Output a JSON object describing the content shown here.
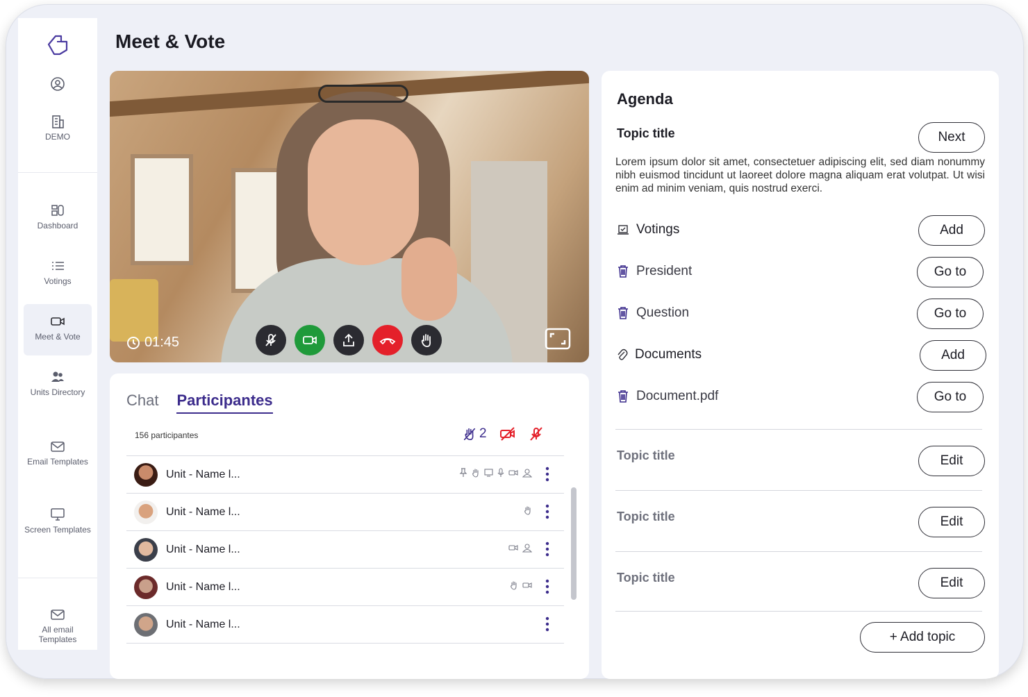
{
  "app": {
    "title": "Meet & Vote"
  },
  "sidebar": {
    "logo_icon": "thumbs-up-hand-icon",
    "items": [
      {
        "label": "",
        "icon": "user-circle-icon"
      },
      {
        "label": "DEMO",
        "icon": "building-icon"
      },
      {
        "label": "Dashboard",
        "icon": "dashboard-icon"
      },
      {
        "label": "Votings",
        "icon": "list-icon"
      },
      {
        "label": "Meet & Vote",
        "icon": "video-icon",
        "active": true
      },
      {
        "label": "Units Directory",
        "icon": "people-icon"
      },
      {
        "label": "Email Templates",
        "icon": "mail-icon"
      },
      {
        "label": "Screen Templates",
        "icon": "monitor-icon"
      },
      {
        "label": "All email Templates",
        "icon": "mail-icon"
      }
    ]
  },
  "video": {
    "timer": "01:45",
    "controls": [
      "mic-off-icon",
      "camera-icon",
      "share-icon",
      "hang-up-icon",
      "raise-hand-icon"
    ],
    "colors": {
      "camera": "#1f9a3a",
      "hangup": "#e4202a",
      "default": "#2b2b31"
    }
  },
  "participants": {
    "tabs": {
      "chat": "Chat",
      "participants": "Participantes"
    },
    "count_label": "156 participantes",
    "raised_hands": "2",
    "rows": [
      {
        "name": "Unit - Name l...",
        "icons": [
          "pin",
          "hand",
          "screen",
          "mic",
          "camera",
          "user"
        ]
      },
      {
        "name": "Unit - Name l...",
        "icons": [
          "hand"
        ]
      },
      {
        "name": "Unit - Name l...",
        "icons": [
          "camera",
          "user"
        ]
      },
      {
        "name": "Unit - Name l...",
        "icons": [
          "hand",
          "camera"
        ]
      },
      {
        "name": "Unit - Name l...",
        "icons": []
      }
    ]
  },
  "agenda": {
    "title": "Agenda",
    "current_topic": "Topic title",
    "next_label": "Next",
    "description": "Lorem ipsum dolor sit amet, consectetuer adipiscing elit, sed diam nonummy nibh euismod tincidunt ut laoreet dolore magna aliquam erat volutpat. Ut wisi enim ad minim veniam, quis nostrud exerci.",
    "votings_label": "Votings",
    "add_label": "Add",
    "voting_items": [
      "President",
      "Question"
    ],
    "goto_label": "Go to",
    "documents_label": "Documents",
    "document_items": [
      "Document.pdf"
    ],
    "other_topics": [
      "Topic title",
      "Topic title",
      "Topic title"
    ],
    "edit_label": "Edit",
    "add_topic_label": "+ Add topic"
  },
  "colors": {
    "accent": "#3c2c8c",
    "danger": "#e4202a",
    "success": "#1f9a3a"
  }
}
